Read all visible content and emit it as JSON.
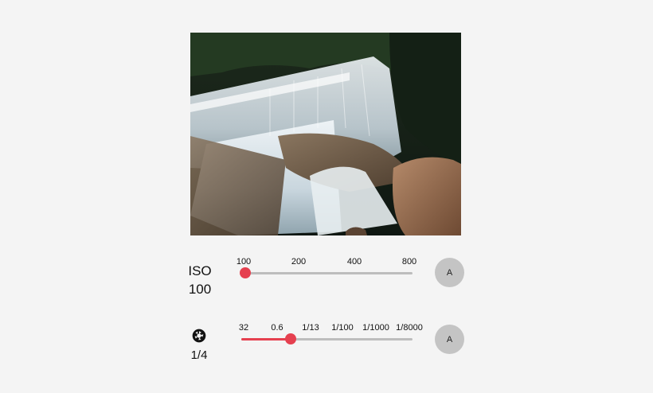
{
  "photo": {
    "subject": "waterfall photo"
  },
  "iso": {
    "label": "ISO",
    "value": "100",
    "ticks": [
      "100",
      "200",
      "400",
      "800"
    ],
    "slider_fraction": 0.0,
    "auto_label": "A"
  },
  "shutter": {
    "icon": "aperture-icon",
    "value": "1/4",
    "ticks": [
      "32",
      "0.6",
      "1/13",
      "1/100",
      "1/1000",
      "1/8000"
    ],
    "slider_fraction": 0.28,
    "auto_label": "A"
  },
  "colors": {
    "accent": "#e5404f",
    "track": "#bdbdbd",
    "button": "#c4c4c4",
    "background": "#f4f4f4"
  }
}
